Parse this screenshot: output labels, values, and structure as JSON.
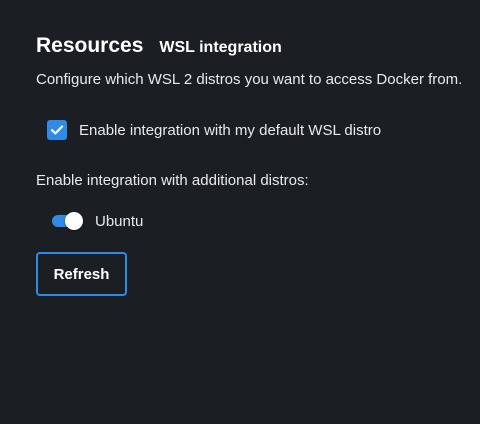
{
  "header": {
    "page_title": "Resources",
    "section_title": "WSL integration"
  },
  "main": {
    "description": "Configure which WSL 2 distros you want to access Docker from.",
    "default_distro": {
      "label": "Enable integration with my default WSL distro",
      "checked": true,
      "icon": "checkmark-icon"
    },
    "additional_label": "Enable integration with additional distros:",
    "distros": [
      {
        "label": "Ubuntu",
        "enabled": true
      }
    ],
    "refresh_label": "Refresh"
  },
  "colors": {
    "background": "#1b1f23",
    "accent": "#2e8be6",
    "text": "#e8eaed"
  }
}
